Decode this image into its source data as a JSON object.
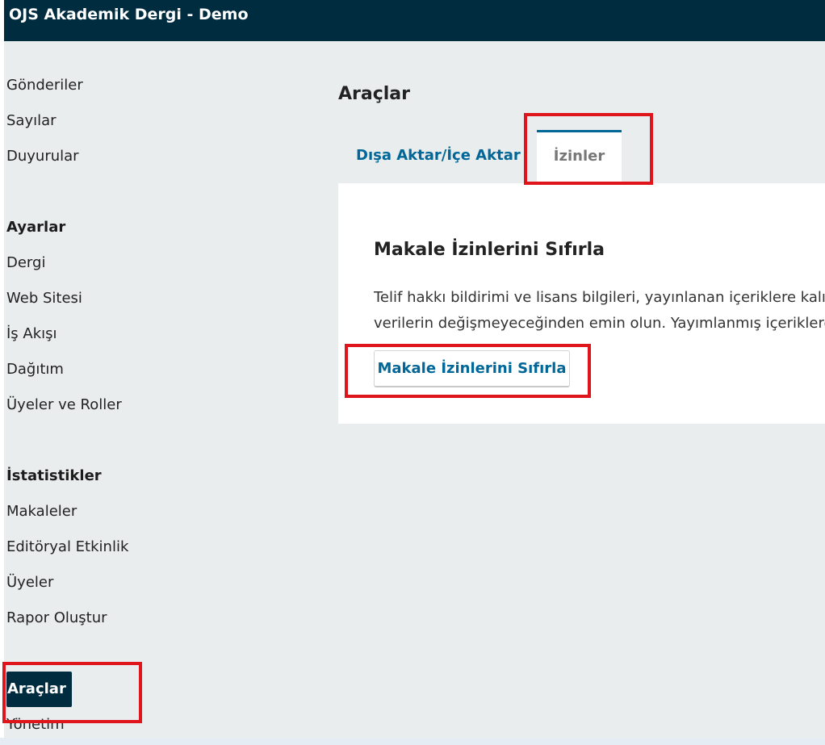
{
  "header": {
    "site_title": "OJS Akademik Dergi - Demo"
  },
  "sidebar": {
    "items": [
      {
        "label": "Gönderiler"
      },
      {
        "label": "Sayılar"
      },
      {
        "label": "Duyurular"
      }
    ],
    "settings_heading": "Ayarlar",
    "settings_items": [
      {
        "label": "Dergi"
      },
      {
        "label": "Web Sitesi"
      },
      {
        "label": "İş Akışı"
      },
      {
        "label": "Dağıtım"
      },
      {
        "label": "Üyeler ve Roller"
      }
    ],
    "stats_heading": "İstatistikler",
    "stats_items": [
      {
        "label": "Makaleler"
      },
      {
        "label": "Editöryal Etkinlik"
      },
      {
        "label": "Üyeler"
      },
      {
        "label": "Rapor Oluştur"
      }
    ],
    "active_item": "Araçlar",
    "admin_item": "Yönetim"
  },
  "main": {
    "page_title": "Araçlar",
    "tabs": [
      {
        "label": "Dışa Aktar/İçe Aktar",
        "active": false
      },
      {
        "label": "İzinler",
        "active": true
      }
    ],
    "panel": {
      "title": "Makale İzinlerini Sıfırla",
      "description_line1": "Telif hakkı bildirimi ve lisans bilgileri, yayınlanan içeriklere kalıcı",
      "description_line2": "verilerin değişmeyeceğinden emin olun. Yayımlanmış içeriklere",
      "button_label": "Makale İzinlerini Sıfırla"
    }
  },
  "colors": {
    "header_bg": "#002c40",
    "accent": "#006798",
    "highlight": "#e0141b",
    "page_bg": "#eaedee"
  }
}
